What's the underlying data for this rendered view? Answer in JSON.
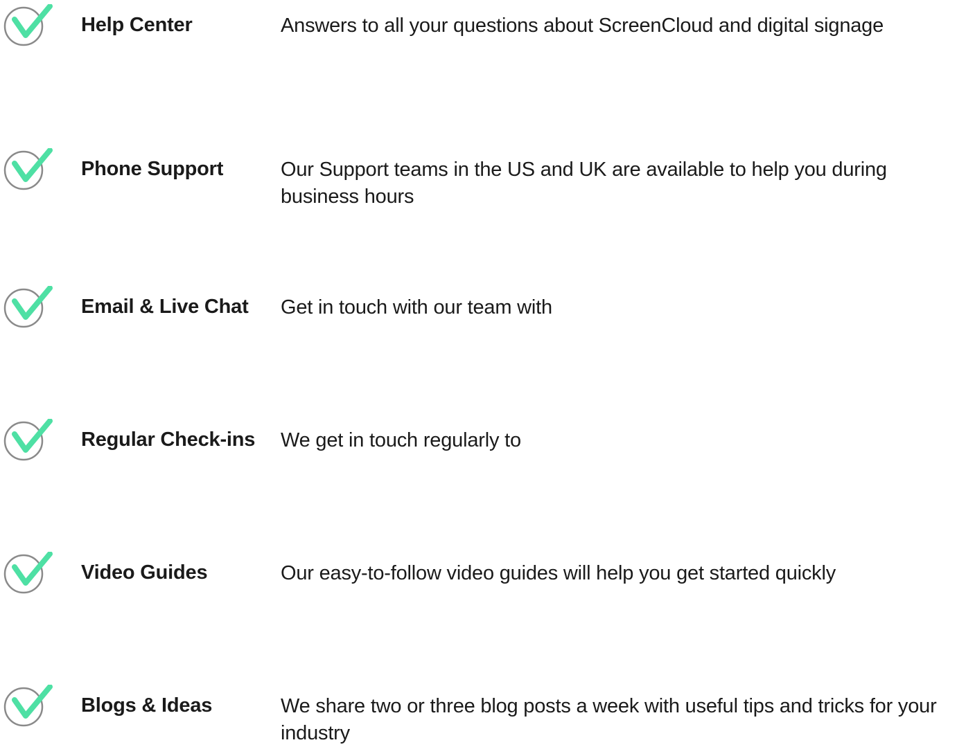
{
  "features": [
    {
      "icon": "check-circle-icon",
      "title": "Help Center",
      "description": "Answers to all your questions about ScreenCloud and digital signage"
    },
    {
      "icon": "check-circle-icon",
      "title": "Phone Support",
      "description": "Our Support teams in the US and UK are available to help you during business hours"
    },
    {
      "icon": "check-circle-icon",
      "title": "Email & Live Chat",
      "description": "Get in touch with our team with"
    },
    {
      "icon": "check-circle-icon",
      "title": "Regular Check-ins",
      "description": "We get in touch regularly to"
    },
    {
      "icon": "check-circle-icon",
      "title": "Video Guides",
      "description": "Our easy-to-follow video guides will help you get started quickly"
    },
    {
      "icon": "check-circle-icon",
      "title": "Blogs & Ideas",
      "description": "We share two or three blog posts a week with useful tips and tricks for your industry"
    }
  ],
  "colors": {
    "check": "#4ee0a4",
    "circle": "#8a8a8a",
    "text": "#1a1a1a"
  }
}
